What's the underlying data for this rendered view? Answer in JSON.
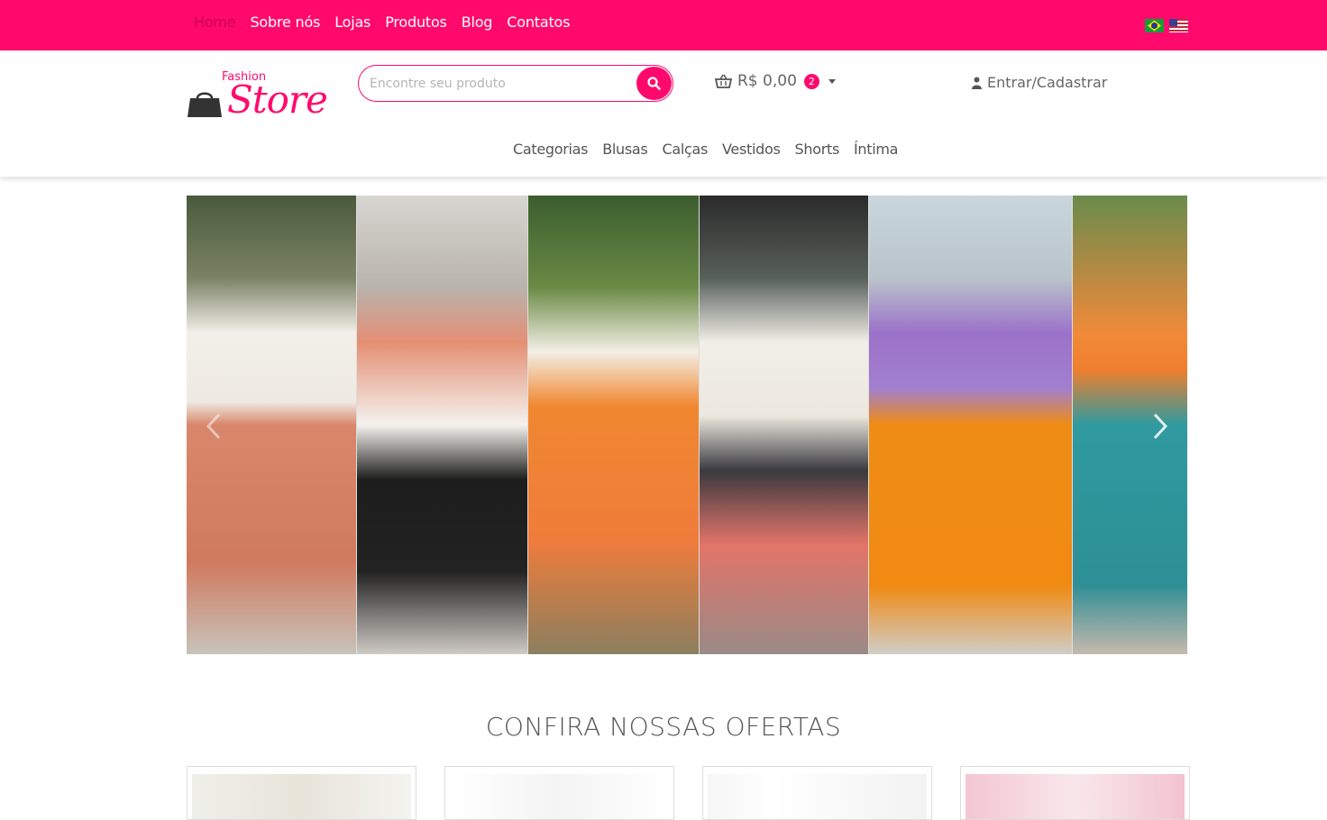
{
  "topnav": {
    "items": [
      {
        "label": "Home",
        "active": true
      },
      {
        "label": "Sobre nós"
      },
      {
        "label": "Lojas"
      },
      {
        "label": "Produtos"
      },
      {
        "label": "Blog"
      },
      {
        "label": "Contatos"
      }
    ]
  },
  "languages": [
    {
      "name": "flag-brazil-icon"
    },
    {
      "name": "flag-usa-icon"
    }
  ],
  "logo": {
    "top": "Fashion",
    "main": "Store"
  },
  "search": {
    "placeholder": "Encontre seu produto",
    "icon": "search-icon"
  },
  "cart": {
    "icon": "basket-icon",
    "total": "R$ 0,00",
    "count": "2"
  },
  "account": {
    "icon": "user-icon",
    "label": "Entrar/Cadastrar"
  },
  "categories": [
    "Categorias",
    "Blusas",
    "Calças",
    "Vestidos",
    "Shorts",
    "Íntima"
  ],
  "carousel": {
    "prev_icon": "chevron-left-icon",
    "next_icon": "chevron-right-icon"
  },
  "offers": {
    "title": "CONFIRA NOSSAS OFERTAS"
  },
  "colors": {
    "brand": "#ff0a6c",
    "text": "#555555"
  }
}
